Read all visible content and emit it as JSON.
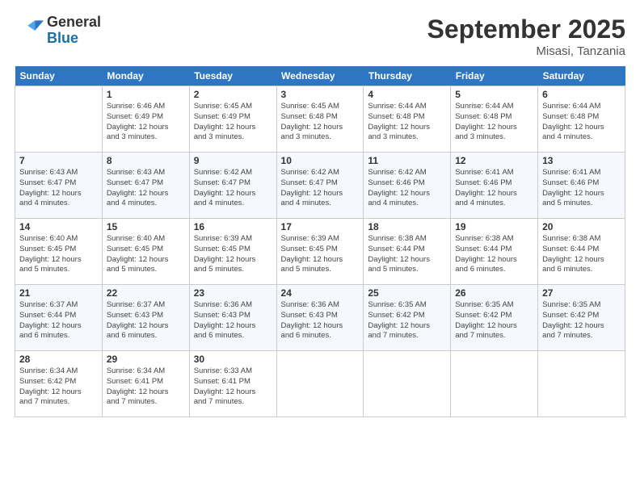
{
  "header": {
    "logo_general": "General",
    "logo_blue": "Blue",
    "month": "September 2025",
    "location": "Misasi, Tanzania"
  },
  "days_of_week": [
    "Sunday",
    "Monday",
    "Tuesday",
    "Wednesday",
    "Thursday",
    "Friday",
    "Saturday"
  ],
  "weeks": [
    [
      {
        "num": "",
        "info": ""
      },
      {
        "num": "1",
        "info": "Sunrise: 6:46 AM\nSunset: 6:49 PM\nDaylight: 12 hours\nand 3 minutes."
      },
      {
        "num": "2",
        "info": "Sunrise: 6:45 AM\nSunset: 6:49 PM\nDaylight: 12 hours\nand 3 minutes."
      },
      {
        "num": "3",
        "info": "Sunrise: 6:45 AM\nSunset: 6:48 PM\nDaylight: 12 hours\nand 3 minutes."
      },
      {
        "num": "4",
        "info": "Sunrise: 6:44 AM\nSunset: 6:48 PM\nDaylight: 12 hours\nand 3 minutes."
      },
      {
        "num": "5",
        "info": "Sunrise: 6:44 AM\nSunset: 6:48 PM\nDaylight: 12 hours\nand 3 minutes."
      },
      {
        "num": "6",
        "info": "Sunrise: 6:44 AM\nSunset: 6:48 PM\nDaylight: 12 hours\nand 4 minutes."
      }
    ],
    [
      {
        "num": "7",
        "info": "Sunrise: 6:43 AM\nSunset: 6:47 PM\nDaylight: 12 hours\nand 4 minutes."
      },
      {
        "num": "8",
        "info": "Sunrise: 6:43 AM\nSunset: 6:47 PM\nDaylight: 12 hours\nand 4 minutes."
      },
      {
        "num": "9",
        "info": "Sunrise: 6:42 AM\nSunset: 6:47 PM\nDaylight: 12 hours\nand 4 minutes."
      },
      {
        "num": "10",
        "info": "Sunrise: 6:42 AM\nSunset: 6:47 PM\nDaylight: 12 hours\nand 4 minutes."
      },
      {
        "num": "11",
        "info": "Sunrise: 6:42 AM\nSunset: 6:46 PM\nDaylight: 12 hours\nand 4 minutes."
      },
      {
        "num": "12",
        "info": "Sunrise: 6:41 AM\nSunset: 6:46 PM\nDaylight: 12 hours\nand 4 minutes."
      },
      {
        "num": "13",
        "info": "Sunrise: 6:41 AM\nSunset: 6:46 PM\nDaylight: 12 hours\nand 5 minutes."
      }
    ],
    [
      {
        "num": "14",
        "info": "Sunrise: 6:40 AM\nSunset: 6:45 PM\nDaylight: 12 hours\nand 5 minutes."
      },
      {
        "num": "15",
        "info": "Sunrise: 6:40 AM\nSunset: 6:45 PM\nDaylight: 12 hours\nand 5 minutes."
      },
      {
        "num": "16",
        "info": "Sunrise: 6:39 AM\nSunset: 6:45 PM\nDaylight: 12 hours\nand 5 minutes."
      },
      {
        "num": "17",
        "info": "Sunrise: 6:39 AM\nSunset: 6:45 PM\nDaylight: 12 hours\nand 5 minutes."
      },
      {
        "num": "18",
        "info": "Sunrise: 6:38 AM\nSunset: 6:44 PM\nDaylight: 12 hours\nand 5 minutes."
      },
      {
        "num": "19",
        "info": "Sunrise: 6:38 AM\nSunset: 6:44 PM\nDaylight: 12 hours\nand 6 minutes."
      },
      {
        "num": "20",
        "info": "Sunrise: 6:38 AM\nSunset: 6:44 PM\nDaylight: 12 hours\nand 6 minutes."
      }
    ],
    [
      {
        "num": "21",
        "info": "Sunrise: 6:37 AM\nSunset: 6:44 PM\nDaylight: 12 hours\nand 6 minutes."
      },
      {
        "num": "22",
        "info": "Sunrise: 6:37 AM\nSunset: 6:43 PM\nDaylight: 12 hours\nand 6 minutes."
      },
      {
        "num": "23",
        "info": "Sunrise: 6:36 AM\nSunset: 6:43 PM\nDaylight: 12 hours\nand 6 minutes."
      },
      {
        "num": "24",
        "info": "Sunrise: 6:36 AM\nSunset: 6:43 PM\nDaylight: 12 hours\nand 6 minutes."
      },
      {
        "num": "25",
        "info": "Sunrise: 6:35 AM\nSunset: 6:42 PM\nDaylight: 12 hours\nand 7 minutes."
      },
      {
        "num": "26",
        "info": "Sunrise: 6:35 AM\nSunset: 6:42 PM\nDaylight: 12 hours\nand 7 minutes."
      },
      {
        "num": "27",
        "info": "Sunrise: 6:35 AM\nSunset: 6:42 PM\nDaylight: 12 hours\nand 7 minutes."
      }
    ],
    [
      {
        "num": "28",
        "info": "Sunrise: 6:34 AM\nSunset: 6:42 PM\nDaylight: 12 hours\nand 7 minutes."
      },
      {
        "num": "29",
        "info": "Sunrise: 6:34 AM\nSunset: 6:41 PM\nDaylight: 12 hours\nand 7 minutes."
      },
      {
        "num": "30",
        "info": "Sunrise: 6:33 AM\nSunset: 6:41 PM\nDaylight: 12 hours\nand 7 minutes."
      },
      {
        "num": "",
        "info": ""
      },
      {
        "num": "",
        "info": ""
      },
      {
        "num": "",
        "info": ""
      },
      {
        "num": "",
        "info": ""
      }
    ]
  ]
}
